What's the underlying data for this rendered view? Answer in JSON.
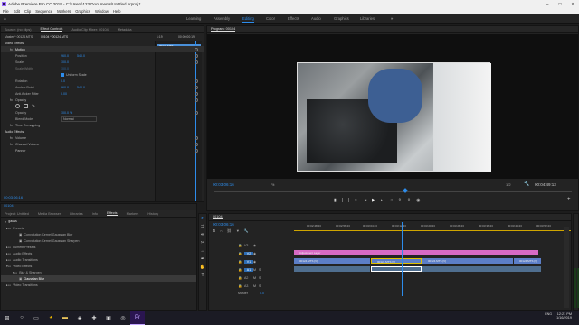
{
  "window": {
    "title": "Adobe Premiere Pro CC 2019 - C:\\Users\\123\\Documents\\Untitled.prproj *"
  },
  "menu": [
    "File",
    "Edit",
    "Clip",
    "Sequence",
    "Markers",
    "Graphics",
    "Window",
    "Help"
  ],
  "workspaces": {
    "items": [
      "Learning",
      "Assembly",
      "Editing",
      "Color",
      "Effects",
      "Audio",
      "Graphics",
      "Libraries"
    ],
    "active": "Editing",
    "more": "»"
  },
  "source_panel": {
    "tabs": [
      "Source: (no clips)",
      "Effect Controls",
      "Audio Clip Mixer: 00104",
      "Metadata"
    ],
    "active_tab": "Effect Controls",
    "master_label": "Master * 00124.MTS",
    "seq_label": "00104 * 00124.MTS",
    "time_label": "1:19",
    "time_mark": "00:00:00:19",
    "clip_tag": "00124.MTS",
    "video_effects_heading": "Video Effects",
    "motion": "Motion",
    "rows": [
      {
        "label": "Position",
        "v1": "960.0",
        "v2": "540.0"
      },
      {
        "label": "Scale",
        "v1": "100.0",
        "v2": ""
      },
      {
        "label": "Scale Width",
        "v1": "100.0",
        "v2": ""
      },
      {
        "label": "",
        "v1": "",
        "v2": "Uniform Scale"
      },
      {
        "label": "Rotation",
        "v1": "0.0",
        "v2": ""
      },
      {
        "label": "Anchor Point",
        "v1": "960.0",
        "v2": "540.0"
      },
      {
        "label": "Anti-flicker Filter",
        "v1": "0.00",
        "v2": ""
      }
    ],
    "opacity": "Opacity",
    "opacity_rows": [
      {
        "label": "Opacity",
        "v1": "100.0 %",
        "v2": ""
      },
      {
        "label": "Blend Mode",
        "v1": "Normal",
        "v2": ""
      }
    ],
    "time_remap": "Time Remapping",
    "audio_effects_heading": "Audio Effects",
    "audio_rows": [
      "Volume",
      "Channel Volume",
      "Panner"
    ],
    "timecode": "00:03:06:16"
  },
  "program": {
    "title": "Program: 00104",
    "timecode": "00:03:06:16",
    "fit": "Fit",
    "fraction": "1/2",
    "duration": "00:04:49:13",
    "controls": [
      "mark-in",
      "mark-out",
      "go-to-in",
      "step-back",
      "play",
      "step-forward",
      "go-to-out",
      "lift",
      "extract",
      "export-frame",
      "add"
    ]
  },
  "project": {
    "tabs": [
      "Project: Untitled",
      "Media Browser",
      "Libraries",
      "Info",
      "Effects",
      "Markers",
      "History"
    ],
    "active_tab": "Effects",
    "search": "gauss",
    "items": [
      {
        "label": "Presets",
        "indent": 1
      },
      {
        "label": "Convolution Kernel Gaussian Blur",
        "indent": 3
      },
      {
        "label": "Convolution Kernel Gaussian Sharpen",
        "indent": 3
      },
      {
        "label": "Lumetri Presets",
        "indent": 1
      },
      {
        "label": "Audio Effects",
        "indent": 1
      },
      {
        "label": "Audio Transitions",
        "indent": 1
      },
      {
        "label": "Video Effects",
        "indent": 1
      },
      {
        "label": "Blur & Sharpen",
        "indent": 2
      },
      {
        "label": "Gaussian Blur",
        "indent": 3,
        "selected": true
      },
      {
        "label": "Video Transitions",
        "indent": 1
      }
    ]
  },
  "timeline": {
    "tab": "00104",
    "timecode": "00:03:06:16",
    "ruler": [
      "00:02:48:23",
      "00:02:56:23",
      "00:03:04:23",
      "00:03:12:23",
      "00:03:20:23",
      "00:03:28:23",
      "00:03:36:23",
      "00:03:44:23",
      "00:03:52:23"
    ],
    "tracks": [
      "V3",
      "V2",
      "V1",
      "A1",
      "A2",
      "A3"
    ],
    "master": "Master",
    "master_val": "0.0",
    "adjustment": "Adjustment Layer",
    "clips_v1": [
      "00124.MTS [V]",
      "00124.MTS [V]",
      "00124.MTS [V]",
      "00124.MTS [V]"
    ]
  },
  "taskbar": {
    "time": "12:21 PM",
    "date": "1/16/2019",
    "lang": "ENG"
  }
}
